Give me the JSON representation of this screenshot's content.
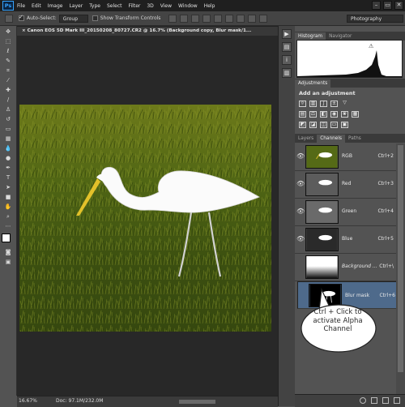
{
  "app": {
    "logo": "Ps"
  },
  "menu": [
    "File",
    "Edit",
    "Image",
    "Layer",
    "Type",
    "Select",
    "Filter",
    "3D",
    "View",
    "Window",
    "Help"
  ],
  "window_controls": [
    "–",
    "▭",
    "✕"
  ],
  "options_bar": {
    "auto_select_label": "Auto-Select:",
    "auto_select_value": "Group",
    "show_transform_label": "Show Transform Controls",
    "workspace": "Photography"
  },
  "document": {
    "tab_title": "× Canon EOS 5D Mark III_20150208_80727.CR2 @ 16.7% (Background copy, Blur mask/1...",
    "zoom": "16.67%",
    "doc_info": "Doc: 97.1M/232.0M"
  },
  "panels": {
    "histogram_tabs": [
      "Histogram",
      "Navigator"
    ],
    "adjustments_tab": "Adjustments",
    "adjustments_title": "Add an adjustment",
    "layer_tabs": [
      "Layers",
      "Channels",
      "Paths"
    ]
  },
  "channels": [
    {
      "name": "RGB",
      "shortcut": "Ctrl+2",
      "thumb": "color"
    },
    {
      "name": "Red",
      "shortcut": "Ctrl+3",
      "thumb": "gray"
    },
    {
      "name": "Green",
      "shortcut": "Ctrl+4",
      "thumb": "gray"
    },
    {
      "name": "Blue",
      "shortcut": "Ctrl+5",
      "thumb": "dark"
    },
    {
      "name": "Background ...",
      "shortcut": "Ctrl+\\",
      "thumb": "gradient"
    },
    {
      "name": "Blur mask",
      "shortcut": "Ctrl+6",
      "thumb": "mask"
    }
  ],
  "callout": {
    "line1": "Ctrl  + Click to",
    "line2": "activate Alpha",
    "line3": "Channel"
  },
  "colors": {
    "accent": "#4e6a8b",
    "ps_blue": "#35a3ff"
  }
}
